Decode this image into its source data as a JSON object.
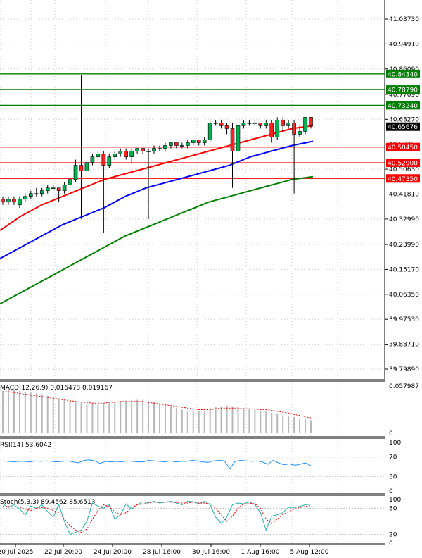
{
  "chart_data": [
    {
      "type": "candlestick",
      "panel": "price",
      "y_ticks": [
        "41.03730",
        "40.94910",
        "40.86090",
        "40.77090",
        "40.68270",
        "40.59450",
        "40.50630",
        "40.41810",
        "40.32990",
        "40.23990",
        "40.15170",
        "40.06350",
        "39.97530",
        "39.88710",
        "39.79890"
      ],
      "ylim": [
        39.7989,
        41.0373
      ],
      "x_ticks": [
        "20 Jul 2025",
        "22 Jul 20:00",
        "24 Jul 20:00",
        "28 Jul 16:00",
        "30 Jul 16:00",
        "1 Aug 16:00",
        "5 Aug 12:00"
      ],
      "levels": [
        {
          "label": "40.84340",
          "value": 40.8434,
          "color": "#008000"
        },
        {
          "label": "40.78790",
          "value": 40.7879,
          "color": "#008000"
        },
        {
          "label": "40.73240",
          "value": 40.7324,
          "color": "#008000"
        },
        {
          "label": "40.58450",
          "value": 40.5845,
          "color": "#ff0000"
        },
        {
          "label": "40.52900",
          "value": 40.529,
          "color": "#ff0000"
        },
        {
          "label": "40.47350",
          "value": 40.4735,
          "color": "#ff0000"
        }
      ],
      "current_price": {
        "label": "40.65676",
        "value": 40.65676
      },
      "moving_averages": [
        {
          "color": "#ff0000",
          "values": [
            40.29,
            40.34,
            40.38,
            40.41,
            40.44,
            40.47,
            40.49,
            40.51,
            40.53,
            40.55,
            40.57,
            40.59,
            40.61,
            40.63,
            40.65,
            40.66
          ]
        },
        {
          "color": "#0000ff",
          "values": [
            40.19,
            40.23,
            40.27,
            40.31,
            40.34,
            40.37,
            40.41,
            40.44,
            40.46,
            40.48,
            40.5,
            40.52,
            40.55,
            40.57,
            40.59,
            40.605
          ]
        },
        {
          "color": "#008000",
          "values": [
            40.03,
            40.07,
            40.11,
            40.15,
            40.19,
            40.23,
            40.27,
            40.3,
            40.33,
            40.36,
            40.39,
            40.41,
            40.43,
            40.45,
            40.47,
            40.48
          ]
        }
      ],
      "candles": [
        [
          40.4,
          40.39,
          40.41,
          40.38
        ],
        [
          40.39,
          40.4,
          40.41,
          40.38
        ],
        [
          40.4,
          40.39,
          40.41,
          40.38
        ],
        [
          40.38,
          40.4,
          40.41,
          40.37
        ],
        [
          40.4,
          40.41,
          40.42,
          40.39
        ],
        [
          40.41,
          40.42,
          40.43,
          40.4
        ],
        [
          40.42,
          40.42,
          40.44,
          40.41
        ],
        [
          40.42,
          40.43,
          40.44,
          40.41
        ],
        [
          40.43,
          40.44,
          40.45,
          40.42
        ],
        [
          40.44,
          40.44,
          40.45,
          40.43
        ],
        [
          40.44,
          40.43,
          40.44,
          40.39
        ],
        [
          40.43,
          40.45,
          40.46,
          40.42
        ],
        [
          40.45,
          40.47,
          40.48,
          40.44
        ],
        [
          40.47,
          40.52,
          40.54,
          40.46
        ],
        [
          40.52,
          40.5,
          40.84,
          40.33
        ],
        [
          40.5,
          40.53,
          40.54,
          40.49
        ],
        [
          40.53,
          40.55,
          40.56,
          40.52
        ],
        [
          40.55,
          40.56,
          40.57,
          40.54
        ],
        [
          40.56,
          40.52,
          40.57,
          40.28
        ],
        [
          40.52,
          40.55,
          40.56,
          40.51
        ],
        [
          40.55,
          40.56,
          40.57,
          40.54
        ],
        [
          40.56,
          40.57,
          40.58,
          40.55
        ],
        [
          40.57,
          40.55,
          40.58,
          40.54
        ],
        [
          40.55,
          40.57,
          40.58,
          40.53
        ],
        [
          40.57,
          40.58,
          40.58,
          40.56
        ],
        [
          40.58,
          40.57,
          40.58,
          40.56
        ],
        [
          40.57,
          40.57,
          40.58,
          40.33
        ],
        [
          40.57,
          40.58,
          40.59,
          40.56
        ],
        [
          40.58,
          40.58,
          40.59,
          40.57
        ],
        [
          40.58,
          40.59,
          40.6,
          40.57
        ],
        [
          40.59,
          40.6,
          40.6,
          40.58
        ],
        [
          40.6,
          40.59,
          40.6,
          40.58
        ],
        [
          40.59,
          40.59,
          40.6,
          40.58
        ],
        [
          40.59,
          40.6,
          40.61,
          40.58
        ],
        [
          40.6,
          40.61,
          40.61,
          40.59
        ],
        [
          40.61,
          40.6,
          40.61,
          40.59
        ],
        [
          40.6,
          40.61,
          40.62,
          40.59
        ],
        [
          40.61,
          40.67,
          40.68,
          40.6
        ],
        [
          40.67,
          40.67,
          40.68,
          40.66
        ],
        [
          40.67,
          40.66,
          40.68,
          40.65
        ],
        [
          40.66,
          40.65,
          40.67,
          40.63
        ],
        [
          40.65,
          40.57,
          40.67,
          40.44
        ],
        [
          40.57,
          40.66,
          40.67,
          40.46
        ],
        [
          40.66,
          40.67,
          40.68,
          40.65
        ],
        [
          40.67,
          40.67,
          40.68,
          40.66
        ],
        [
          40.67,
          40.67,
          40.68,
          40.66
        ],
        [
          40.67,
          40.66,
          40.67,
          40.65
        ],
        [
          40.66,
          40.67,
          40.68,
          40.65
        ],
        [
          40.67,
          40.62,
          40.68,
          40.6
        ],
        [
          40.62,
          40.68,
          40.69,
          40.61
        ],
        [
          40.68,
          40.66,
          40.69,
          40.64
        ],
        [
          40.66,
          40.67,
          40.68,
          40.65
        ],
        [
          40.67,
          40.63,
          40.68,
          40.42
        ],
        [
          40.63,
          40.64,
          40.66,
          40.62
        ],
        [
          40.64,
          40.69,
          40.69,
          40.63
        ],
        [
          40.69,
          40.66,
          40.69,
          40.65
        ]
      ]
    },
    {
      "type": "histogram",
      "panel": "macd",
      "label": "MACD(12,26,9) 0.016478 0.019167",
      "y_ticks": [
        "0.057987",
        "0"
      ],
      "ylim": [
        0,
        0.057987
      ],
      "histogram": [
        0.052,
        0.053,
        0.053,
        0.052,
        0.051,
        0.05,
        0.049,
        0.048,
        0.046,
        0.044,
        0.043,
        0.041,
        0.04,
        0.038,
        0.037,
        0.036,
        0.036,
        0.035,
        0.036,
        0.037,
        0.038,
        0.039,
        0.04,
        0.041,
        0.041,
        0.041,
        0.04,
        0.039,
        0.037,
        0.035,
        0.033,
        0.031,
        0.029,
        0.028,
        0.027,
        0.027,
        0.027,
        0.03,
        0.032,
        0.033,
        0.034,
        0.033,
        0.032,
        0.031,
        0.03,
        0.029,
        0.028,
        0.027,
        0.025,
        0.024,
        0.022,
        0.021,
        0.02,
        0.018,
        0.017,
        0.016
      ],
      "signal": [
        0.051,
        0.051,
        0.05,
        0.049,
        0.048,
        0.047,
        0.046,
        0.045,
        0.044,
        0.043,
        0.042,
        0.041,
        0.04,
        0.039,
        0.038,
        0.038,
        0.037,
        0.037,
        0.037,
        0.038,
        0.038,
        0.039,
        0.039,
        0.039,
        0.039,
        0.039,
        0.038,
        0.037,
        0.036,
        0.035,
        0.034,
        0.033,
        0.032,
        0.031,
        0.03,
        0.029,
        0.029,
        0.029,
        0.03,
        0.031,
        0.031,
        0.031,
        0.031,
        0.03,
        0.03,
        0.03,
        0.029,
        0.029,
        0.028,
        0.027,
        0.026,
        0.025,
        0.023,
        0.022,
        0.02,
        0.019
      ]
    },
    {
      "type": "line",
      "panel": "rsi",
      "label": "RSI(14) 53.6042",
      "y_ticks": [
        "100",
        "70",
        "30",
        "0"
      ],
      "ylim": [
        0,
        100
      ],
      "values": [
        62,
        61,
        60,
        61,
        61,
        60,
        62,
        61,
        62,
        61,
        60,
        61,
        62,
        60,
        58,
        63,
        64,
        62,
        57,
        61,
        60,
        61,
        60,
        62,
        61,
        60,
        60,
        63,
        62,
        61,
        60,
        62,
        60,
        61,
        61,
        63,
        62,
        60,
        59,
        62,
        63,
        62,
        46,
        61,
        63,
        62,
        61,
        62,
        60,
        55,
        63,
        58,
        54,
        56,
        53,
        55,
        58,
        52
      ]
    },
    {
      "type": "line",
      "panel": "stoch",
      "label": "Stoch(5,3,3) 89.4562 85.6513",
      "y_ticks": [
        "100",
        "80",
        "20",
        "0"
      ],
      "ylim": [
        0,
        100
      ],
      "main": [
        90,
        82,
        88,
        78,
        65,
        85,
        80,
        88,
        72,
        60,
        88,
        50,
        20,
        25,
        30,
        50,
        92,
        85,
        80,
        88,
        55,
        65,
        90,
        78,
        88,
        95,
        92,
        96,
        92,
        94,
        96,
        92,
        88,
        96,
        95,
        90,
        96,
        88,
        60,
        45,
        60,
        88,
        92,
        90,
        95,
        88,
        70,
        30,
        62,
        65,
        70,
        82,
        82,
        84,
        88,
        89
      ],
      "signal": [
        85,
        84,
        83,
        82,
        78,
        75,
        80,
        82,
        80,
        75,
        70,
        55,
        40,
        30,
        25,
        32,
        55,
        75,
        88,
        84,
        72,
        65,
        70,
        82,
        88,
        90,
        92,
        94,
        94,
        94,
        94,
        93,
        92,
        92,
        94,
        92,
        92,
        90,
        80,
        65,
        50,
        62,
        80,
        90,
        92,
        90,
        80,
        55,
        45,
        55,
        66,
        72,
        78,
        82,
        84,
        86
      ]
    }
  ]
}
